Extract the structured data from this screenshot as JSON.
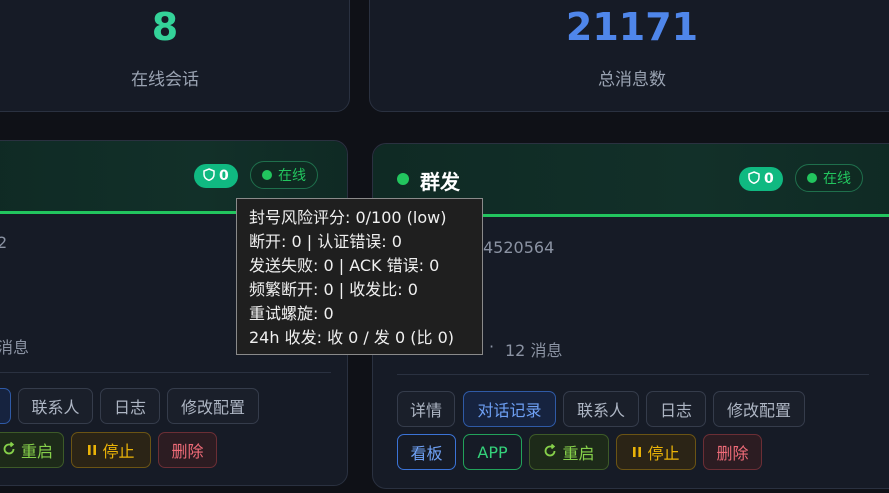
{
  "stats": [
    {
      "value": "8",
      "label": "在线会话",
      "color": "#34d399"
    },
    {
      "value": "21171",
      "label": "总消息数",
      "color": "#3b82f6"
    }
  ],
  "left_card": {
    "shield_count": "0",
    "status": "在线",
    "info_partial": "2",
    "messages_partial": "消息",
    "buttons_row1": [
      "联系人",
      "日志",
      "修改配置"
    ],
    "buttons_row2": [
      "重启",
      "停止",
      "删除"
    ]
  },
  "right_card": {
    "name": "群发",
    "shield_count": "0",
    "status": "在线",
    "id_partial": "4520564",
    "sep": "·",
    "messages": "12 消息",
    "buttons_row1": [
      "详情",
      "对话记录",
      "联系人",
      "日志",
      "修改配置"
    ],
    "buttons_row2": [
      "看板",
      "APP",
      "重启",
      "停止",
      "删除"
    ]
  },
  "tooltip": {
    "lines": [
      "封号风险评分: 0/100 (low)",
      "断开: 0 | 认证错误: 0",
      "发送失败: 0 | ACK 错误: 0",
      "频繁断开: 0 | 收发比: 0",
      "重试螺旋: 0",
      "24h 收发: 收 0 / 发 0 (比 0)"
    ]
  },
  "colors": {
    "accent_green": "#22c55e",
    "accent_blue": "#3b82f6",
    "danger": "#ef6b78",
    "warning": "#eab308"
  },
  "icons": {
    "shield": "shield-icon",
    "restart": "restart-icon",
    "pause": "pause-icon",
    "status_dot": "status-dot-icon"
  }
}
